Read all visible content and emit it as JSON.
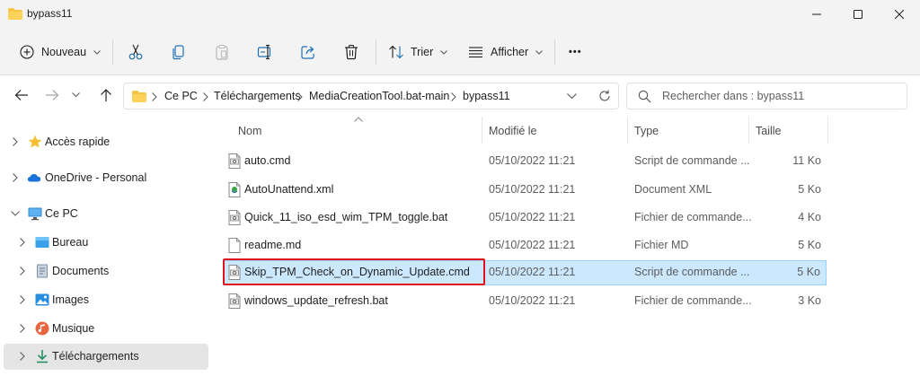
{
  "window": {
    "title": "bypass11"
  },
  "toolbar": {
    "new_label": "Nouveau",
    "sort_label": "Trier",
    "view_label": "Afficher",
    "more_label": "•••"
  },
  "address": {
    "breadcrumbs": [
      "Ce PC",
      "Téléchargements",
      "MediaCreationTool.bat-main",
      "bypass11"
    ]
  },
  "search": {
    "placeholder": "Rechercher dans : bypass11"
  },
  "sidebar": {
    "items": [
      {
        "label": "Accès rapide",
        "icon": "star-icon"
      },
      {
        "label": "OneDrive - Personal",
        "icon": "cloud-icon"
      },
      {
        "label": "Ce PC",
        "icon": "monitor-icon"
      },
      {
        "label": "Bureau",
        "icon": "desktop-icon"
      },
      {
        "label": "Documents",
        "icon": "document-icon"
      },
      {
        "label": "Images",
        "icon": "picture-icon"
      },
      {
        "label": "Musique",
        "icon": "music-icon"
      },
      {
        "label": "Téléchargements",
        "icon": "download-icon"
      }
    ]
  },
  "columns": {
    "name": "Nom",
    "modified": "Modifié le",
    "type": "Type",
    "size": "Taille"
  },
  "files": [
    {
      "name": "auto.cmd",
      "modified": "05/10/2022 11:21",
      "type": "Script de commande ...",
      "size": "11 Ko",
      "icon": "script-file-icon"
    },
    {
      "name": "AutoUnattend.xml",
      "modified": "05/10/2022 11:21",
      "type": "Document XML",
      "size": "5 Ko",
      "icon": "xml-file-icon"
    },
    {
      "name": "Quick_11_iso_esd_wim_TPM_toggle.bat",
      "modified": "05/10/2022 11:21",
      "type": "Fichier de commande...",
      "size": "4 Ko",
      "icon": "script-file-icon"
    },
    {
      "name": "readme.md",
      "modified": "05/10/2022 11:21",
      "type": "Fichier MD",
      "size": "5 Ko",
      "icon": "blank-file-icon"
    },
    {
      "name": "Skip_TPM_Check_on_Dynamic_Update.cmd",
      "modified": "05/10/2022 11:21",
      "type": "Script de commande ...",
      "size": "5 Ko",
      "icon": "script-file-icon"
    },
    {
      "name": "windows_update_refresh.bat",
      "modified": "05/10/2022 11:21",
      "type": "Fichier de commande...",
      "size": "3 Ko",
      "icon": "script-file-icon"
    }
  ],
  "colors": {
    "selection_bg": "#cce8ff",
    "selection_border": "#99d1ff",
    "highlight_box": "#e0141e",
    "folder_yellow": "#f6c543"
  }
}
